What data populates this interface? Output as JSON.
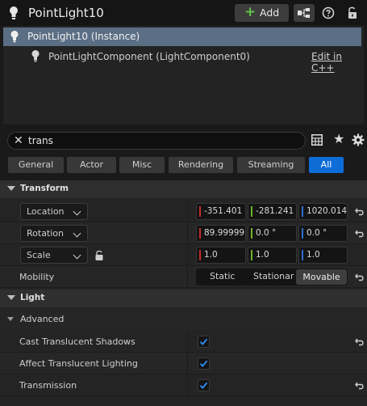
{
  "header": {
    "title": "PointLight10",
    "add_label": "Add"
  },
  "tree": {
    "instance_label": "PointLight10 (Instance)",
    "component_label": "PointLightComponent (LightComponent0)",
    "edit_link": "Edit in C++"
  },
  "search": {
    "value": "trans"
  },
  "tabs": [
    "General",
    "Actor",
    "Misc",
    "Rendering",
    "Streaming",
    "All"
  ],
  "active_tab": "All",
  "transform": {
    "category": "Transform",
    "location": {
      "label": "Location",
      "x": "-351.401",
      "y": "-281.241",
      "z": "1020.014"
    },
    "rotation": {
      "label": "Rotation",
      "x": "89.99999",
      "y": "0.0 °",
      "z": "0.0 °"
    },
    "scale": {
      "label": "Scale",
      "x": "1.0",
      "y": "1.0",
      "z": "1.0"
    },
    "mobility": {
      "label": "Mobility",
      "options": [
        "Static",
        "Stationar",
        "Movable"
      ],
      "selected": "Movable"
    }
  },
  "light": {
    "category": "Light",
    "advanced": "Advanced",
    "props": [
      {
        "label": "Cast Translucent Shadows",
        "checked": true
      },
      {
        "label": "Affect Translucent Lighting",
        "checked": true
      },
      {
        "label": "Transmission",
        "checked": true
      }
    ]
  },
  "colors": {
    "x_axis": "#c52c2c",
    "y_axis": "#6cb32a",
    "z_axis": "#2f6fd0",
    "accent": "#0e6cd7",
    "selection": "#5a6e84"
  }
}
